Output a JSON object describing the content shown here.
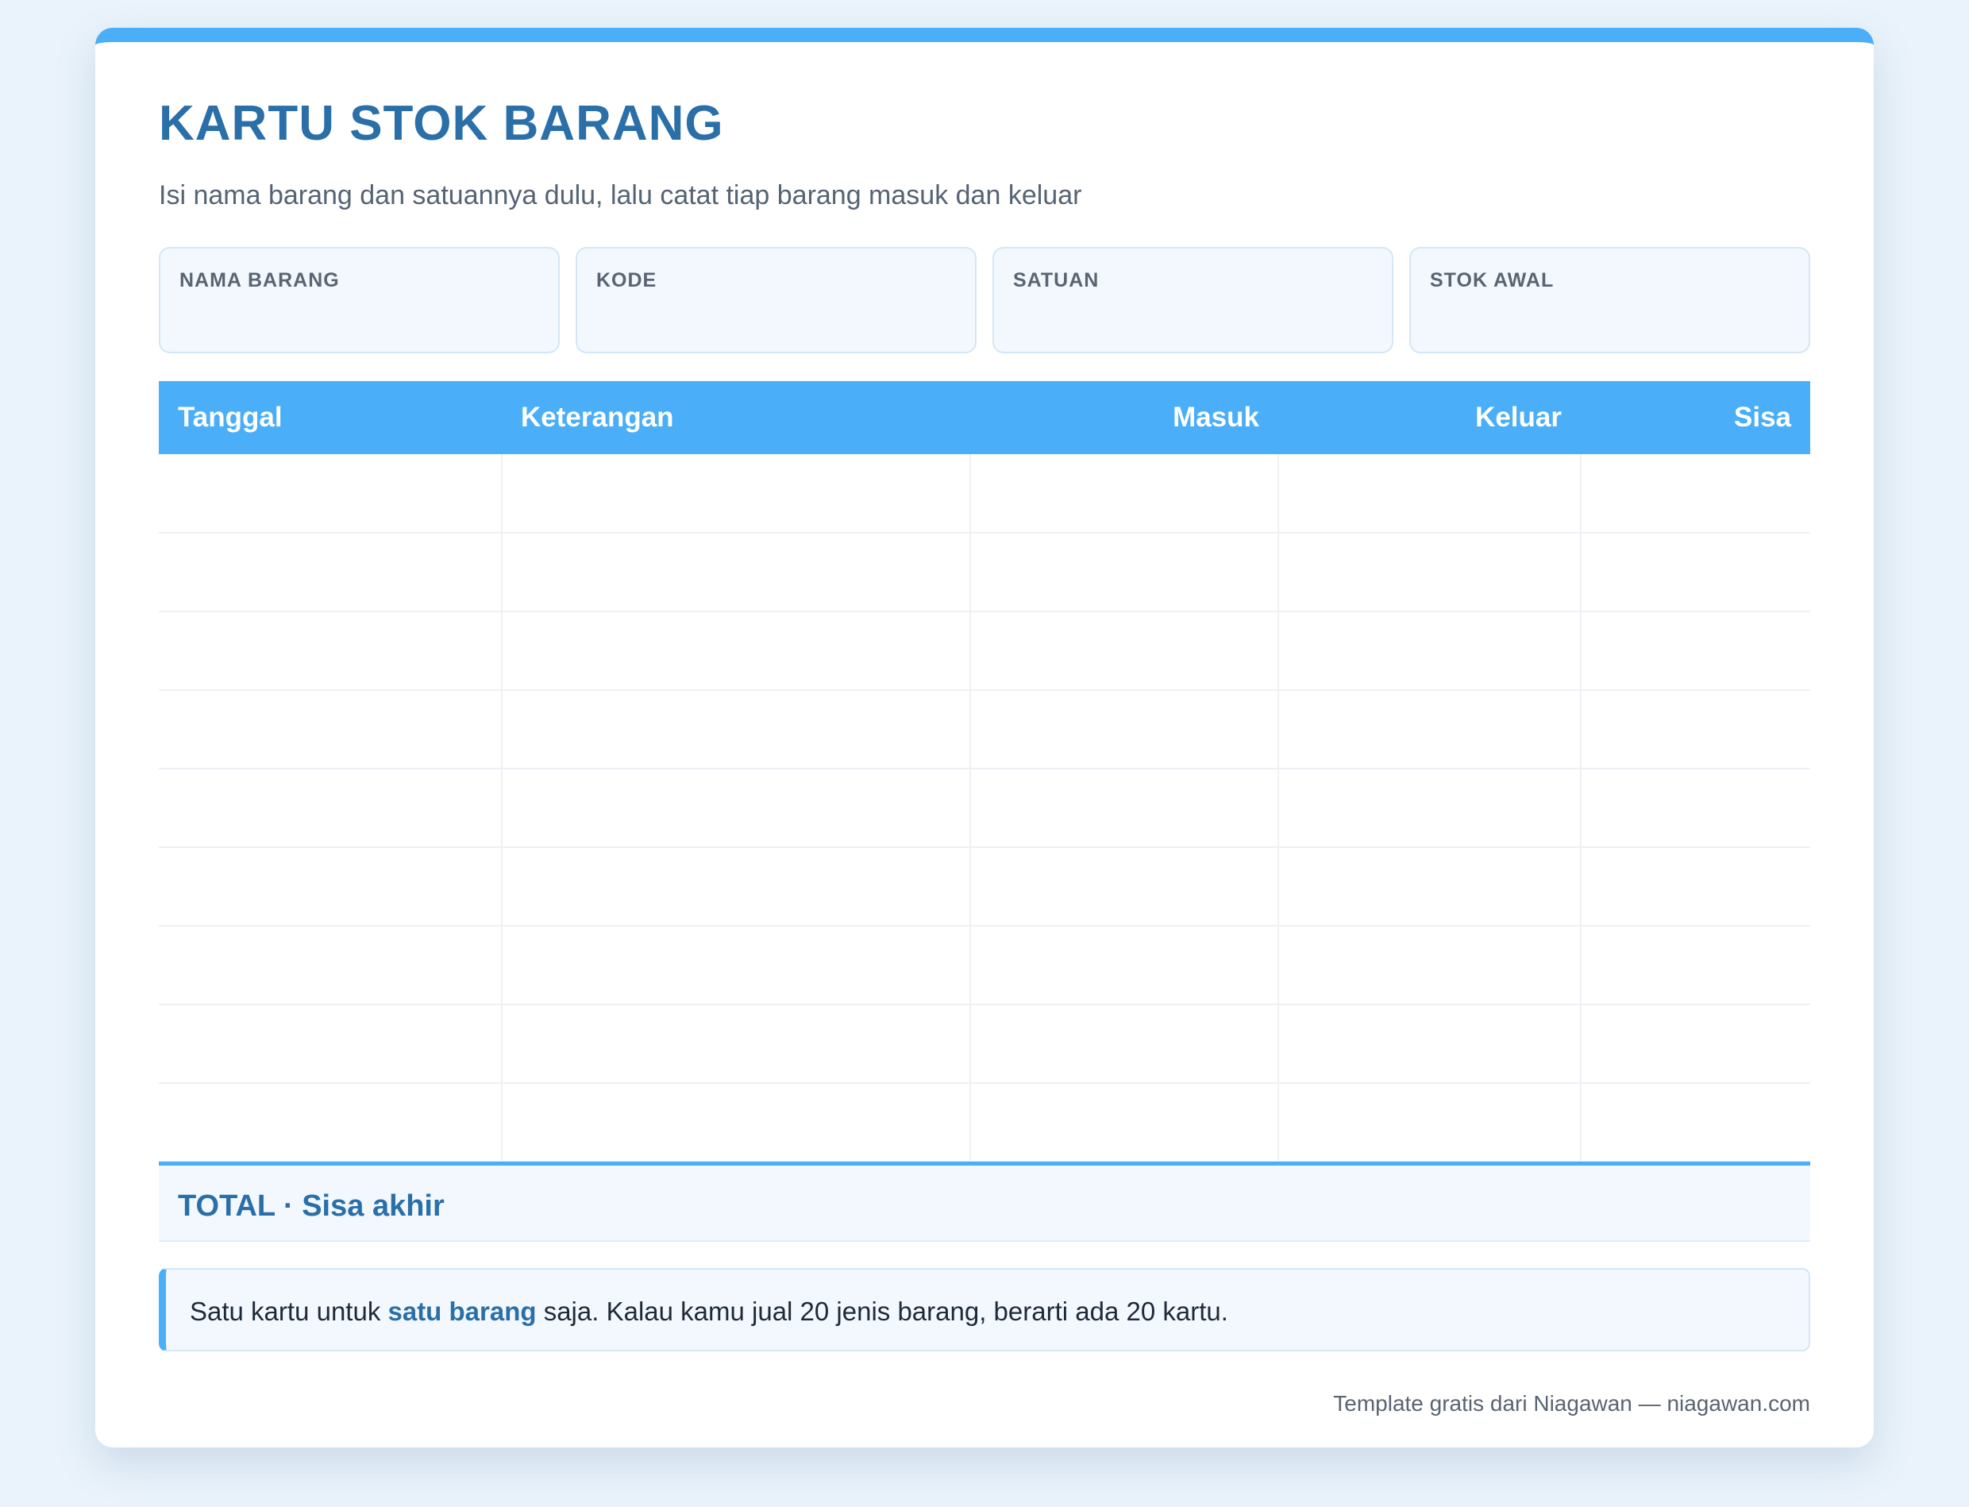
{
  "header": {
    "title": "KARTU STOK BARANG",
    "subtitle": "Isi nama barang dan satuannya dulu, lalu catat tiap barang masuk dan keluar"
  },
  "fields": [
    {
      "label": "NAMA BARANG",
      "value": ""
    },
    {
      "label": "KODE",
      "value": ""
    },
    {
      "label": "SATUAN",
      "value": ""
    },
    {
      "label": "STOK AWAL",
      "value": ""
    }
  ],
  "table": {
    "columns": [
      "Tanggal",
      "Keterangan",
      "Masuk",
      "Keluar",
      "Sisa"
    ],
    "rows": [
      [
        "",
        "",
        "",
        "",
        ""
      ],
      [
        "",
        "",
        "",
        "",
        ""
      ],
      [
        "",
        "",
        "",
        "",
        ""
      ],
      [
        "",
        "",
        "",
        "",
        ""
      ],
      [
        "",
        "",
        "",
        "",
        ""
      ],
      [
        "",
        "",
        "",
        "",
        ""
      ],
      [
        "",
        "",
        "",
        "",
        ""
      ],
      [
        "",
        "",
        "",
        "",
        ""
      ],
      [
        "",
        "",
        "",
        "",
        ""
      ]
    ]
  },
  "total": {
    "label": "TOTAL · Sisa akhir"
  },
  "note": {
    "before": "Satu kartu untuk ",
    "highlight": "satu barang",
    "after": " saja. Kalau kamu jual 20 jenis barang, berarti ada 20 kartu."
  },
  "footer": {
    "text": "Template gratis dari Niagawan — niagawan.com"
  },
  "colors": {
    "accent": "#4aaef8",
    "title": "#2a6fa8",
    "background": "#eaf3fb"
  }
}
